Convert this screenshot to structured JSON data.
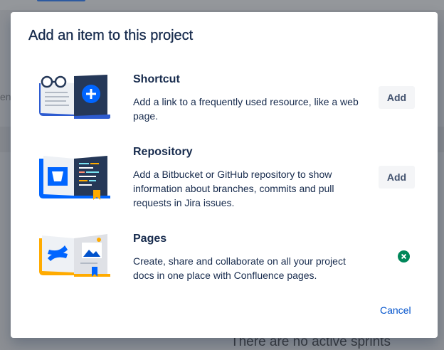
{
  "background": {
    "fragment_text": "ent",
    "empty_state": "There are no active sprints"
  },
  "modal": {
    "title": "Add an item to this project",
    "items": [
      {
        "name": "Shortcut",
        "description": "Add a link to a frequently used resource, like a web page.",
        "action_label": "Add",
        "icon": "shortcut-book-illustration"
      },
      {
        "name": "Repository",
        "description": "Add a Bitbucket or GitHub repository to show information about branches, commits and pull requests in Jira issues.",
        "action_label": "Add",
        "icon": "repository-book-illustration"
      },
      {
        "name": "Pages",
        "description": "Create, share and collaborate on all your project docs in one place with Confluence pages.",
        "status": "added",
        "status_icon": "added-check-icon",
        "icon": "confluence-book-illustration"
      }
    ],
    "cancel_label": "Cancel"
  },
  "colors": {
    "accent": "#0052cc",
    "text": "#172b4d",
    "button_text": "#42526e",
    "button_bg": "#f4f5f7",
    "success": "#00875a",
    "confluence_yellow": "#ffab00"
  }
}
